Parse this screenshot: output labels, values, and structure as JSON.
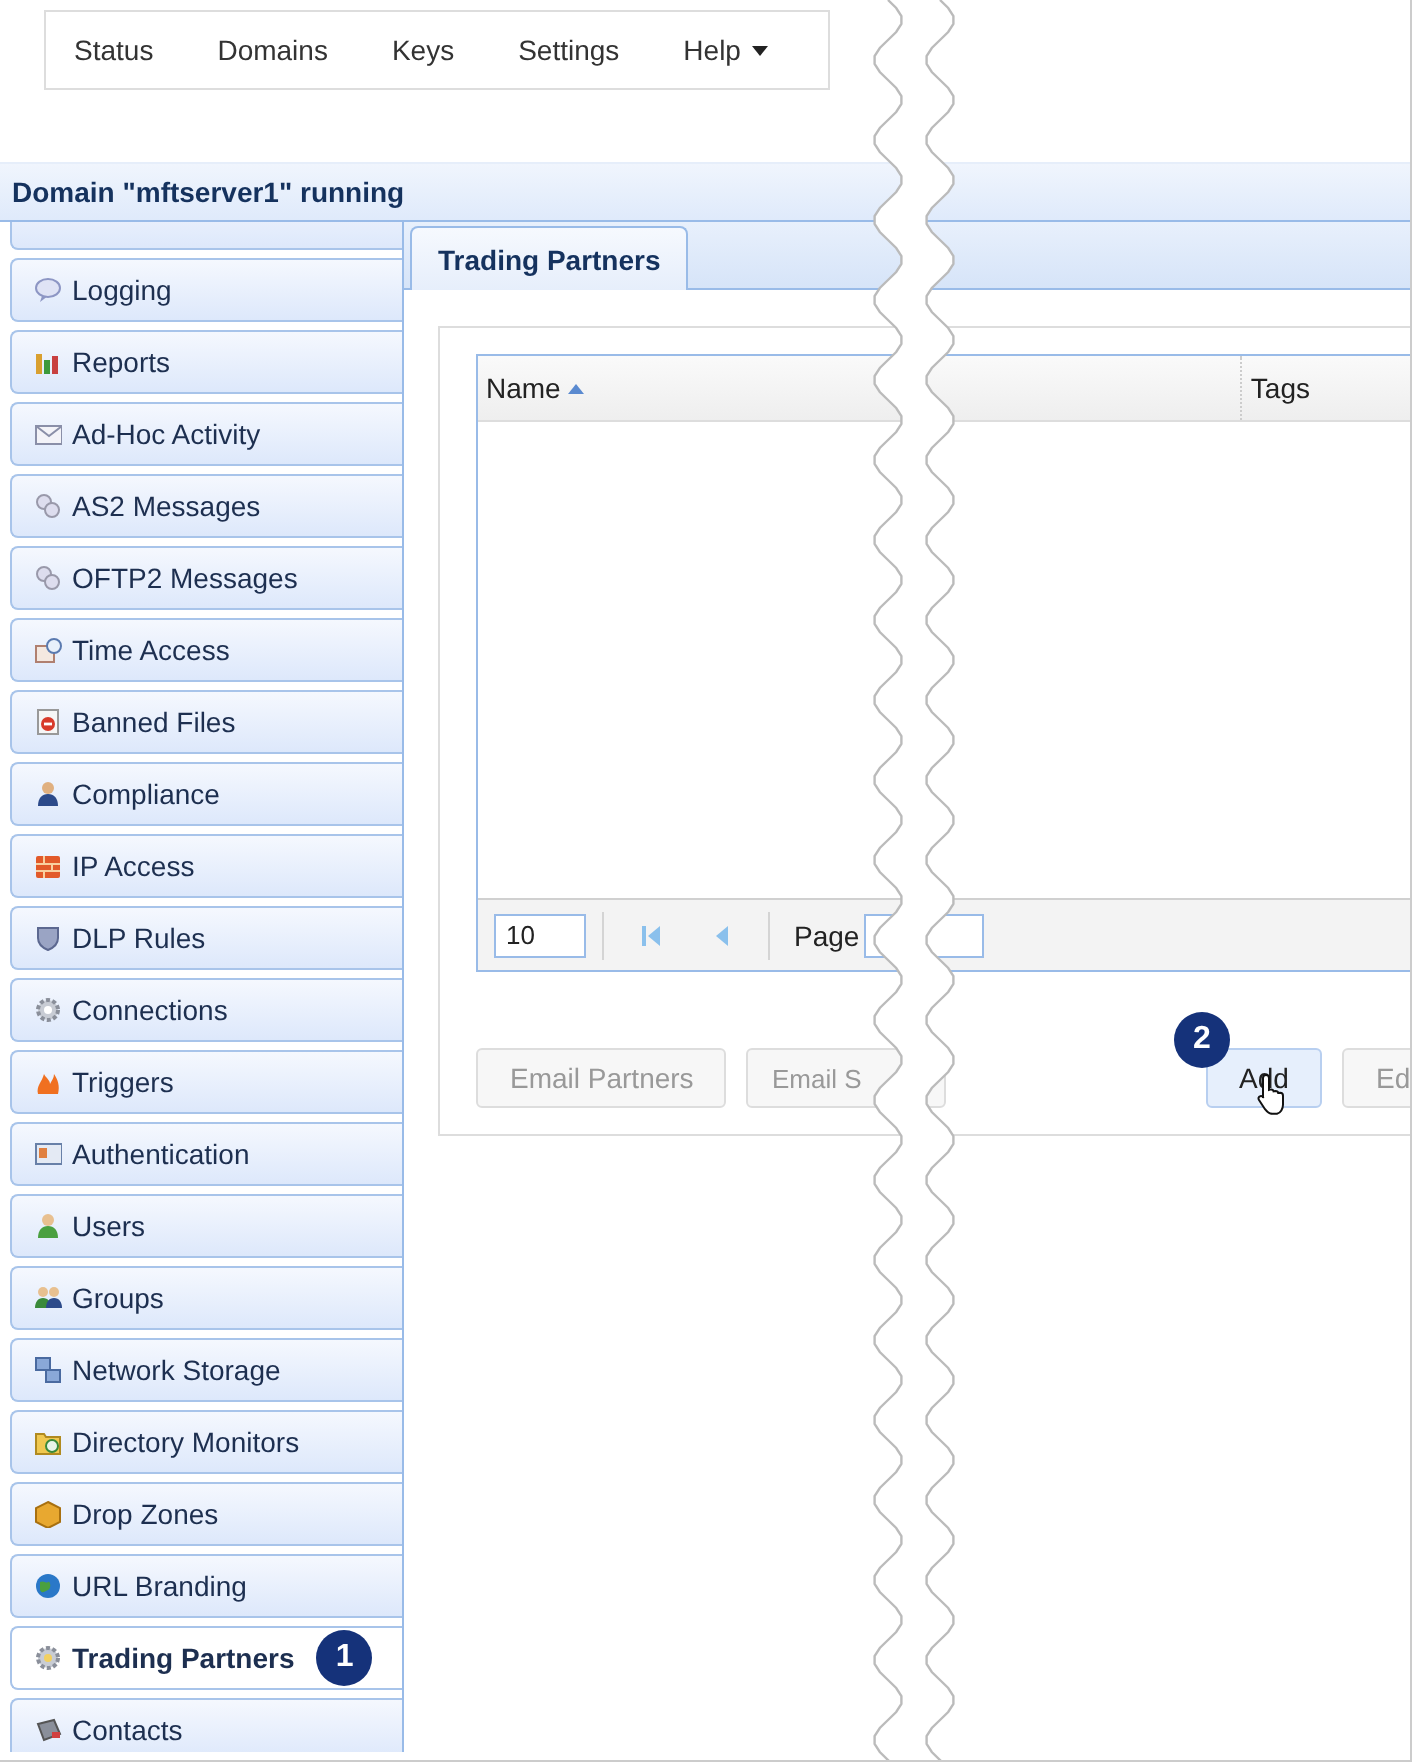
{
  "top_nav": {
    "items": [
      {
        "label": "Status",
        "dropdown": false
      },
      {
        "label": "Domains",
        "dropdown": false
      },
      {
        "label": "Keys",
        "dropdown": false
      },
      {
        "label": "Settings",
        "dropdown": false
      },
      {
        "label": "Help",
        "dropdown": true
      }
    ]
  },
  "domain_status": "Domain \"mftserver1\" running",
  "sidebar": {
    "items": [
      {
        "label": "Logging",
        "selected": false
      },
      {
        "label": "Reports",
        "selected": false
      },
      {
        "label": "Ad-Hoc Activity",
        "selected": false
      },
      {
        "label": "AS2 Messages",
        "selected": false
      },
      {
        "label": "OFTP2 Messages",
        "selected": false
      },
      {
        "label": "Time Access",
        "selected": false
      },
      {
        "label": "Banned Files",
        "selected": false
      },
      {
        "label": "Compliance",
        "selected": false
      },
      {
        "label": "IP Access",
        "selected": false
      },
      {
        "label": "DLP Rules",
        "selected": false
      },
      {
        "label": "Connections",
        "selected": false
      },
      {
        "label": "Triggers",
        "selected": false
      },
      {
        "label": "Authentication",
        "selected": false
      },
      {
        "label": "Users",
        "selected": false
      },
      {
        "label": "Groups",
        "selected": false
      },
      {
        "label": "Network Storage",
        "selected": false
      },
      {
        "label": "Directory Monitors",
        "selected": false
      },
      {
        "label": "Drop Zones",
        "selected": false
      },
      {
        "label": "URL Branding",
        "selected": false
      },
      {
        "label": "Trading Partners",
        "selected": true,
        "badge": "1"
      },
      {
        "label": "Contacts",
        "selected": false
      }
    ]
  },
  "tabs": [
    {
      "label": "Trading Partners",
      "selected": true
    }
  ],
  "grid": {
    "columns": [
      {
        "label": "Name",
        "sorted": true
      },
      {
        "label": "Tags",
        "sorted": false
      }
    ],
    "page_size": "10",
    "page_label": "Page"
  },
  "buttons": [
    {
      "label": "Email Partners",
      "disabled": true,
      "hovered": false
    },
    {
      "label": "Email S",
      "disabled": true,
      "hovered": false
    },
    {
      "label": "Add",
      "disabled": false,
      "hovered": true,
      "badge": "2"
    },
    {
      "label": "Ed",
      "disabled": true,
      "hovered": false
    }
  ]
}
